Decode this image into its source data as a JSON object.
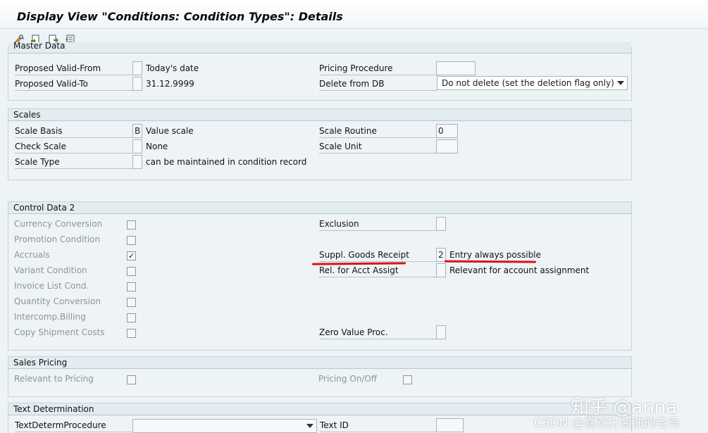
{
  "window": {
    "title": "Display View \"Conditions: Condition Types\": Details"
  },
  "toolbar": {
    "icons": [
      "display-change-icon",
      "other-entry-icon",
      "next-entry-icon",
      "previous-entry-icon"
    ]
  },
  "master_data": {
    "title": "Master Data",
    "proposed_valid_from": {
      "label": "Proposed Valid-From",
      "value": "",
      "text": "Today's date"
    },
    "proposed_valid_to": {
      "label": "Proposed Valid-To",
      "value": "",
      "text": "31.12.9999"
    },
    "pricing_procedure": {
      "label": "Pricing Procedure",
      "value": ""
    },
    "delete_from_db": {
      "label": "Delete from DB",
      "value": "Do not delete (set the deletion flag only)"
    }
  },
  "scales": {
    "title": "Scales",
    "scale_basis": {
      "label": "Scale Basis",
      "value": "B",
      "text": "Value scale"
    },
    "check_scale": {
      "label": "Check Scale",
      "value": "",
      "text": "None"
    },
    "scale_type": {
      "label": "Scale Type",
      "value": "",
      "text": "can be maintained in condition record"
    },
    "scale_routine": {
      "label": "Scale Routine",
      "value": "0"
    },
    "scale_unit": {
      "label": "Scale Unit",
      "value": ""
    }
  },
  "control_data_2": {
    "title": "Control Data 2",
    "checkboxes": [
      {
        "label": "Currency Conversion",
        "checked": false
      },
      {
        "label": "Promotion Condition",
        "checked": false
      },
      {
        "label": "Accruals",
        "checked": true
      },
      {
        "label": "Variant Condition",
        "checked": false
      },
      {
        "label": "Invoice List Cond.",
        "checked": false
      },
      {
        "label": "Quantity Conversion",
        "checked": false
      },
      {
        "label": "Intercomp.Billing",
        "checked": false
      },
      {
        "label": "Copy Shipment Costs",
        "checked": false
      }
    ],
    "exclusion": {
      "label": "Exclusion",
      "value": ""
    },
    "suppl_goods_receipt": {
      "label": "Suppl. Goods Receipt",
      "value": "2",
      "text": "Entry always possible"
    },
    "rel_acct_assigt": {
      "label": "Rel. for Acct Assigt",
      "value": "",
      "text": "Relevant for account assignment"
    },
    "zero_value_proc": {
      "label": "Zero Value Proc.",
      "value": ""
    }
  },
  "sales_pricing": {
    "title": "Sales Pricing",
    "relevant_to_pricing": {
      "label": "Relevant to Pricing",
      "checked": false
    },
    "pricing_on_off": {
      "label": "Pricing On/Off",
      "checked": false
    }
  },
  "text_determination": {
    "title": "Text Determination",
    "text_determ_procedure": {
      "label": "TextDetermProcedure",
      "value": ""
    },
    "text_id": {
      "label": "Text ID",
      "value": ""
    }
  },
  "watermarks": {
    "zhihu": "知乎 @anna",
    "csdn": "CSDN @喜欢打酱油的老鸟"
  },
  "colors": {
    "annotation": "#d41616",
    "title_bg": "#f1f5f8",
    "group_header": "#e3ecf1"
  }
}
